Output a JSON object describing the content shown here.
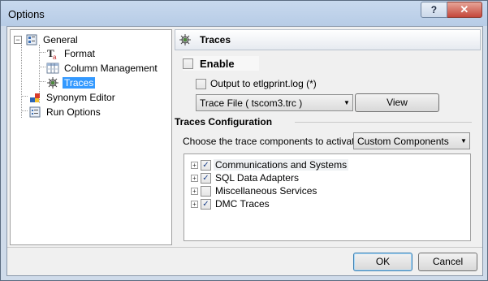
{
  "window": {
    "title": "Options",
    "help_label": "?",
    "close_label": "✕"
  },
  "tree": {
    "items": [
      {
        "label": "General",
        "expander": "−"
      },
      {
        "label": "Format"
      },
      {
        "label": "Column Management"
      },
      {
        "label": "Traces",
        "selected": true
      },
      {
        "label": "Synonym Editor"
      },
      {
        "label": "Run Options"
      }
    ]
  },
  "panel": {
    "header": "Traces",
    "enable_label": "Enable",
    "output_label": "Output to etlgprint.log (*)",
    "trace_file_value": "Trace File ( tscom3.trc )",
    "view_button": "View",
    "config_title": "Traces Configuration",
    "choose_label": "Choose the trace components to activate:",
    "components_value": "Custom Components",
    "components": [
      {
        "label": "Communications and Systems",
        "checked": true
      },
      {
        "label": "SQL Data Adapters",
        "checked": true
      },
      {
        "label": "Miscellaneous Services",
        "checked": false
      },
      {
        "label": "DMC Traces",
        "checked": true
      }
    ]
  },
  "footer": {
    "ok_label": "OK",
    "cancel_label": "Cancel"
  },
  "colors": {
    "selection": "#3399ff",
    "default_button_border": "#3c7fb1"
  }
}
